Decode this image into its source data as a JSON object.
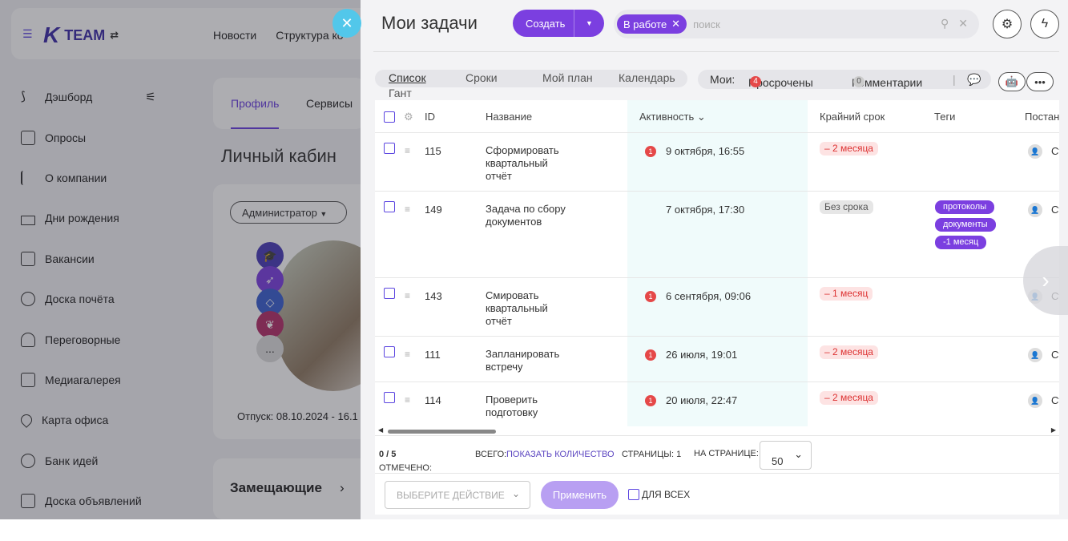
{
  "app": {
    "logo_text": "TEAM",
    "topnav": [
      "Новости",
      "Структура ко"
    ],
    "sidebar": [
      "Дэшборд",
      "Опросы",
      "О компании",
      "Дни рождения",
      "Вакансии",
      "Доска почёта",
      "Переговорные",
      "Медиагалерея",
      "Карта офиса",
      "Банк идей",
      "Доска объявлений"
    ],
    "profile_tabs": [
      "Профиль",
      "Сервисы"
    ],
    "cabinet_title": "Личный кабин",
    "role_select": "Администратор",
    "avatar_more": "...",
    "vacation": "Отпуск:  08.10.2024 - 16.1",
    "substitutes_title": "Замещающие"
  },
  "panel": {
    "title": "Мои задачи",
    "create_label": "Создать",
    "filter_chip": "В работе",
    "search_placeholder": "поиск",
    "view_tabs": [
      "Список",
      "Сроки",
      "Мой план",
      "Календарь",
      "Гант"
    ],
    "filters": {
      "mine_label": "Мои:",
      "overdue_label": "Просрочены",
      "overdue_count": "4",
      "comments_label": "Комментарии",
      "comments_count": "0"
    },
    "columns": [
      "ID",
      "Название",
      "Активность",
      "Крайний срок",
      "Теги",
      "Постан"
    ],
    "rows": [
      {
        "id": "115",
        "title": "Сформировать квартальный отчёт",
        "badge": "1",
        "activity": "9 октября, 16:55",
        "due": "– 2 месяца",
        "tags": [],
        "person": "Ст"
      },
      {
        "id": "149",
        "title": "Задача по сбору документов",
        "badge": "",
        "activity": "7 октября, 17:30",
        "due": "Без срока",
        "tags": [
          "протоколы",
          "документы",
          "-1 месяц"
        ],
        "person": "Ст"
      },
      {
        "id": "143",
        "title": "Смировать квартальный отчёт",
        "badge": "1",
        "activity": "6 сентября, 09:06",
        "due": "– 1 месяц",
        "tags": [],
        "person": "Ст"
      },
      {
        "id": "111",
        "title": "Запланировать встречу",
        "badge": "1",
        "activity": "26 июля, 19:01",
        "due": "– 2 месяца",
        "tags": [],
        "person": "Ст"
      },
      {
        "id": "114",
        "title": "Проверить подготовку",
        "badge": "1",
        "activity": "20 июля, 22:47",
        "due": "– 2 месяца",
        "tags": [],
        "person": "Ст"
      }
    ],
    "footer": {
      "marked_label": "ОТМЕЧЕНО:",
      "marked_value": "0 / 5",
      "total_label": "ВСЕГО:",
      "show_count": "ПОКАЗАТЬ КОЛИЧЕСТВО",
      "pages": "СТРАНИЦЫ: 1",
      "per_page_label": "НА СТРАНИЦЕ:",
      "per_page_value": "50",
      "action_placeholder": "ВЫБЕРИТЕ ДЕЙСТВИЕ",
      "apply_label": "Применить",
      "all_label": "ДЛЯ ВСЕХ"
    }
  },
  "colors": {
    "accent": "#7b3fe0",
    "danger": "#e54848",
    "close_btn": "#52c7ea"
  }
}
